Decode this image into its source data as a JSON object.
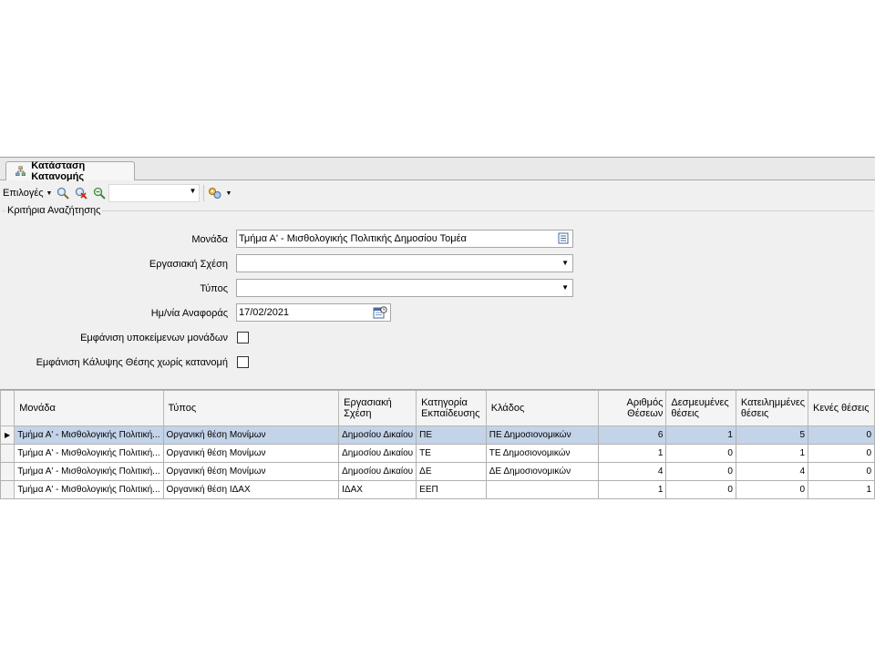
{
  "tab": {
    "title": "Κατάσταση Κατανομής",
    "icon": "hierarchy-icon"
  },
  "toolbar": {
    "options_label": "Επιλογές",
    "combo_value": "",
    "icons": [
      "search-icon",
      "clear-search-icon",
      "filter-icon",
      "tools-icon"
    ]
  },
  "criteria": {
    "title": "Κριτήρια Αναζήτησης",
    "unit_label": "Μονάδα",
    "unit_value": "Τμήμα Α' - Μισθολογικής Πολιτικής Δημοσίου Τομέα",
    "relation_label": "Εργασιακή Σχέση",
    "relation_value": "",
    "type_label": "Τύπος",
    "type_value": "",
    "date_label": "Ημ/νία Αναφοράς",
    "date_value": "17/02/2021",
    "sub_units_label": "Εμφάνιση υποκείμενων μονάδων",
    "uncovered_label": "Εμφάνιση  Κάλυψης Θέσης χωρίς κατανομή"
  },
  "grid": {
    "columns": [
      "Μονάδα",
      "Τύπος",
      "Εργασιακή Σχέση",
      "Κατηγορία Εκπαίδευσης",
      "Κλάδος",
      "Αριθμός Θέσεων",
      "Δεσμευμένες θέσεις",
      "Κατειλημμένες θέσεις",
      "Κενές θέσεις"
    ],
    "rows": [
      {
        "unit": "Τμήμα Α' - Μισθολογικής Πολιτική...",
        "type": "Οργανική θέση Μονίμων",
        "relation": "Δημοσίου Δικαίου",
        "category": "ΠΕ",
        "branch": "ΠΕ Δημοσιονομικών",
        "positions": "6",
        "reserved": "1",
        "occupied": "5",
        "vacant": "0"
      },
      {
        "unit": "Τμήμα Α' - Μισθολογικής Πολιτική...",
        "type": "Οργανική θέση Μονίμων",
        "relation": "Δημοσίου Δικαίου",
        "category": "ΤΕ",
        "branch": "ΤΕ Δημοσιονομικών",
        "positions": "1",
        "reserved": "0",
        "occupied": "1",
        "vacant": "0"
      },
      {
        "unit": "Τμήμα Α' - Μισθολογικής Πολιτική...",
        "type": "Οργανική θέση Μονίμων",
        "relation": "Δημοσίου Δικαίου",
        "category": "ΔΕ",
        "branch": "ΔΕ Δημοσιονομικών",
        "positions": "4",
        "reserved": "0",
        "occupied": "4",
        "vacant": "0"
      },
      {
        "unit": "Τμήμα Α' - Μισθολογικής Πολιτική...",
        "type": "Οργανική θέση ΙΔΑΧ",
        "relation": "ΙΔΑΧ",
        "category": "ΕΕΠ",
        "branch": "",
        "positions": "1",
        "reserved": "0",
        "occupied": "0",
        "vacant": "1"
      }
    ]
  }
}
